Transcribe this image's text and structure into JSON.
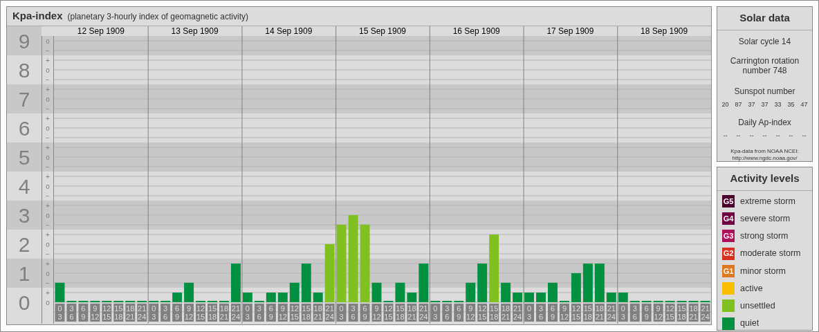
{
  "kpa_chart": {
    "title": "Kpa-index",
    "subtitle": "(planetary 3-hourly index of geomagnetic activity)",
    "days": [
      "12 Sep 1909",
      "13 Sep 1909",
      "14 Sep 1909",
      "15 Sep 1909",
      "16 Sep 1909",
      "17 Sep 1909",
      "18 Sep 1909"
    ],
    "scale_marks": [
      "o",
      "−",
      "+",
      "o",
      "−",
      "+",
      "o",
      "−",
      "+",
      "o",
      "−",
      "+",
      "o",
      "−",
      "+",
      "o",
      "−",
      "+",
      "o",
      "−",
      "+",
      "o",
      "−",
      "+",
      "o",
      "−",
      "+",
      "o"
    ],
    "chart_data": {
      "type": "bar",
      "ylim": [
        -0.74,
        9.5
      ],
      "grid": true,
      "bands": [
        {
          "axis": "y",
          "from": 0.5,
          "to": 1.5
        },
        {
          "axis": "y",
          "from": 2.5,
          "to": 3.5
        },
        {
          "axis": "y",
          "from": 4.5,
          "to": 5.5
        },
        {
          "axis": "y",
          "from": 6.5,
          "to": 7.5
        },
        {
          "axis": "y",
          "from": 8.5,
          "to": 9.5
        }
      ],
      "yticks": [
        {
          "value": 0,
          "label": "0"
        },
        {
          "value": 1,
          "label": "1"
        },
        {
          "value": 2,
          "label": "2"
        },
        {
          "value": 3,
          "label": "3"
        },
        {
          "value": 4,
          "label": "4"
        },
        {
          "value": 5,
          "label": "5"
        },
        {
          "value": 6,
          "label": "6"
        },
        {
          "value": 7,
          "label": "7"
        },
        {
          "value": 8,
          "label": "8"
        },
        {
          "value": 9,
          "label": "9"
        }
      ],
      "categories": [
        "0 3",
        "3 6",
        "6 9",
        "9 12",
        "12 15",
        "15 18",
        "18 21",
        "21 24",
        "0 3",
        "3 6",
        "6 9",
        "9 12",
        "12 15",
        "15 18",
        "18 21",
        "21 24",
        "0 3",
        "3 6",
        "6 9",
        "9 12",
        "12 15",
        "15 18",
        "18 21",
        "21 24",
        "0 3",
        "3 6",
        "6 9",
        "9 12",
        "12 15",
        "15 18",
        "18 21",
        "21 24",
        "0 3",
        "3 6",
        "6 9",
        "9 12",
        "12 15",
        "15 18",
        "18 21",
        "21 24",
        "0 3",
        "3 6",
        "6 9",
        "9 12",
        "12 15",
        "15 18",
        "18 21",
        "21 24",
        "0 3",
        "3 6",
        "6 9",
        "9 12",
        "12 15",
        "15 18",
        "18 21",
        "21 24"
      ],
      "series": [
        {
          "color": "#009040",
          "values": [
            0.67,
            0,
            0,
            0,
            0,
            0,
            0,
            0,
            0,
            0,
            0.33,
            0.67,
            0,
            0,
            0,
            1.33,
            0.33,
            0,
            0.33,
            0.33,
            0.67,
            1.33,
            0.33,
            null,
            null,
            null,
            null,
            0.67,
            0,
            0.67,
            0.33,
            1.33,
            0,
            0,
            0,
            0.67,
            1.33,
            null,
            0.67,
            0.33,
            0.33,
            0.33,
            0.67,
            0,
            1,
            1.33,
            1.33,
            0.33,
            0.33,
            0,
            0,
            0,
            0,
            0,
            0,
            0
          ]
        },
        {
          "color": "#80c020",
          "values": [
            null,
            null,
            null,
            null,
            null,
            null,
            null,
            null,
            null,
            null,
            null,
            null,
            null,
            null,
            null,
            null,
            null,
            null,
            null,
            null,
            null,
            null,
            null,
            2,
            2.67,
            3,
            2.67,
            null,
            null,
            null,
            null,
            null,
            null,
            null,
            null,
            null,
            null,
            2.33,
            null,
            null,
            null,
            null,
            null,
            null,
            null,
            null,
            null,
            null,
            null,
            null,
            null,
            null,
            null,
            null,
            null,
            null
          ]
        }
      ]
    }
  },
  "solar_data": {
    "title": "Solar data",
    "solar_cycle": "Solar cycle 14",
    "carrington_rotation": "Carrington rotation number 748",
    "sunspot_label": "Sunspot number",
    "sunspot_numbers": [
      "20",
      "87",
      "37",
      "37",
      "33",
      "35",
      "47"
    ],
    "ap_label": "Daily Ap-index",
    "ap_values": [
      "--",
      "--",
      "--",
      "--",
      "--",
      "--",
      "--"
    ],
    "source": "Kpa-data from NOAA NCEI:",
    "source_url": "http://www.ngdc.noaa.gov/"
  },
  "activity_levels": {
    "title": "Activity levels",
    "items": [
      {
        "badge": "G5",
        "label": "extreme storm",
        "color": "#4a0028"
      },
      {
        "badge": "G4",
        "label": "severe storm",
        "color": "#6c0040"
      },
      {
        "badge": "G3",
        "label": "strong storm",
        "color": "#b0105a"
      },
      {
        "badge": "G2",
        "label": "moderate storm",
        "color": "#d83020"
      },
      {
        "badge": "G1",
        "label": "minor storm",
        "color": "#e07820"
      },
      {
        "label": "active",
        "color": "#f8c000"
      },
      {
        "label": "unsettled",
        "color": "#80c020"
      },
      {
        "label": "quiet",
        "color": "#009040"
      }
    ]
  }
}
